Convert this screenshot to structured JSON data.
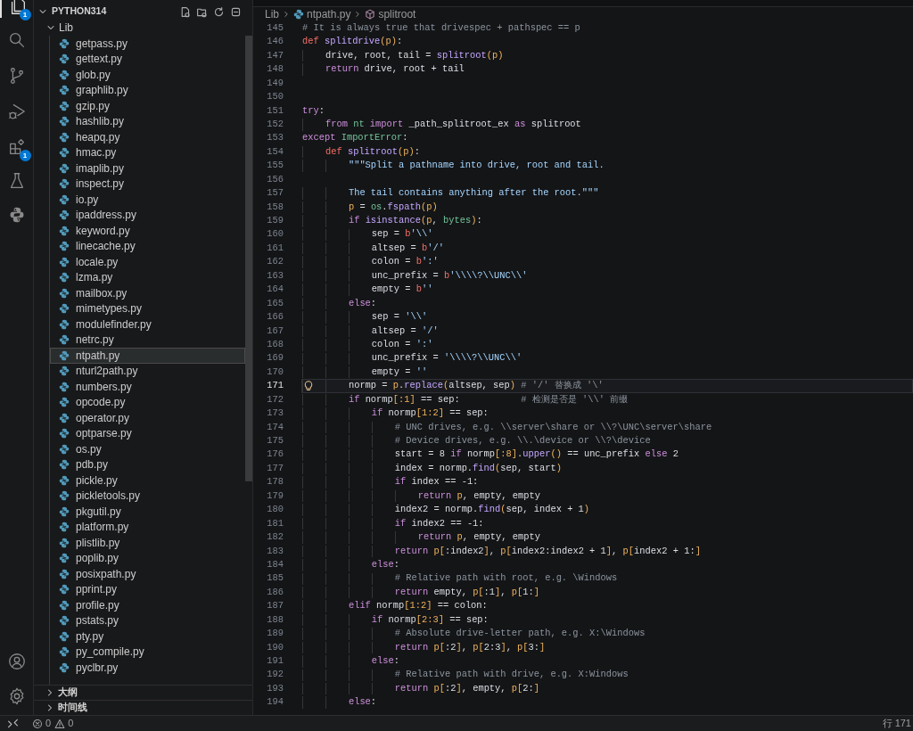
{
  "activity_bar": [
    {
      "kind": "files",
      "badge": "1",
      "selected": true
    },
    {
      "kind": "search",
      "selected": false
    },
    {
      "kind": "source-control",
      "selected": false
    },
    {
      "kind": "run-debug",
      "selected": false
    },
    {
      "kind": "extensions",
      "badge": "1",
      "selected": false
    },
    {
      "kind": "testing",
      "selected": false
    },
    {
      "kind": "python",
      "selected": false
    }
  ],
  "activity_bottom": [
    {
      "kind": "account"
    },
    {
      "kind": "settings"
    }
  ],
  "explorer": {
    "root": "PYTHON314",
    "expanded": true,
    "tree": [
      {
        "name": "Lib",
        "expanded": true,
        "children": [
          {
            "name": "getpass.py",
            "selected": false
          },
          {
            "name": "gettext.py",
            "selected": false
          },
          {
            "name": "glob.py",
            "selected": false
          },
          {
            "name": "graphlib.py",
            "selected": false
          },
          {
            "name": "gzip.py",
            "selected": false
          },
          {
            "name": "hashlib.py",
            "selected": false
          },
          {
            "name": "heapq.py",
            "selected": false
          },
          {
            "name": "hmac.py",
            "selected": false
          },
          {
            "name": "imaplib.py",
            "selected": false
          },
          {
            "name": "inspect.py",
            "selected": false
          },
          {
            "name": "io.py",
            "selected": false
          },
          {
            "name": "ipaddress.py",
            "selected": false
          },
          {
            "name": "keyword.py",
            "selected": false
          },
          {
            "name": "linecache.py",
            "selected": false
          },
          {
            "name": "locale.py",
            "selected": false
          },
          {
            "name": "lzma.py",
            "selected": false
          },
          {
            "name": "mailbox.py",
            "selected": false
          },
          {
            "name": "mimetypes.py",
            "selected": false
          },
          {
            "name": "modulefinder.py",
            "selected": false
          },
          {
            "name": "netrc.py",
            "selected": false
          },
          {
            "name": "ntpath.py",
            "selected": true
          },
          {
            "name": "nturl2path.py",
            "selected": false
          },
          {
            "name": "numbers.py",
            "selected": false
          },
          {
            "name": "opcode.py",
            "selected": false
          },
          {
            "name": "operator.py",
            "selected": false
          },
          {
            "name": "optparse.py",
            "selected": false
          },
          {
            "name": "os.py",
            "selected": false
          },
          {
            "name": "pdb.py",
            "selected": false
          },
          {
            "name": "pickle.py",
            "selected": false
          },
          {
            "name": "pickletools.py",
            "selected": false
          },
          {
            "name": "pkgutil.py",
            "selected": false
          },
          {
            "name": "platform.py",
            "selected": false
          },
          {
            "name": "plistlib.py",
            "selected": false
          },
          {
            "name": "poplib.py",
            "selected": false
          },
          {
            "name": "posixpath.py",
            "selected": false
          },
          {
            "name": "pprint.py",
            "selected": false
          },
          {
            "name": "profile.py",
            "selected": false
          },
          {
            "name": "pstats.py",
            "selected": false
          },
          {
            "name": "pty.py",
            "selected": false
          },
          {
            "name": "py_compile.py",
            "selected": false
          },
          {
            "name": "pyclbr.py",
            "selected": false
          }
        ]
      }
    ],
    "sections": [
      {
        "label": "大纲",
        "expanded": false
      },
      {
        "label": "时间线",
        "expanded": false
      }
    ]
  },
  "breadcrumb": [
    {
      "kind": "folder",
      "label": "Lib"
    },
    {
      "kind": "file",
      "label": "ntpath.py"
    },
    {
      "kind": "symbol",
      "label": "splitroot"
    }
  ],
  "code": [
    {
      "n": "145",
      "current": false,
      "tokens": [
        {
          "text": "# It is always true that drivespec + pathspec == p",
          "kind": "comment"
        }
      ]
    },
    {
      "n": "146",
      "current": false,
      "tokens": [
        {
          "text": "def ",
          "kind": "def"
        },
        {
          "text": "splitdrive",
          "kind": "function"
        },
        {
          "text": "(p)",
          "kind": "param"
        },
        {
          "text": ":",
          "kind": "plain"
        }
      ]
    },
    {
      "n": "147",
      "current": false,
      "tokens": [
        {
          "text": "    drive, root, tail = ",
          "kind": "plain"
        },
        {
          "text": "splitroot",
          "kind": "function"
        },
        {
          "text": "(p)",
          "kind": "param"
        }
      ]
    },
    {
      "n": "148",
      "current": false,
      "tokens": [
        {
          "text": "    return ",
          "kind": "keyword"
        },
        {
          "text": "drive, root + tail",
          "kind": "plain"
        }
      ]
    },
    {
      "n": "149",
      "current": false
    },
    {
      "n": "150",
      "current": false
    },
    {
      "n": "151",
      "current": false,
      "tokens": [
        {
          "text": "try",
          "kind": "keyword"
        },
        {
          "text": ":",
          "kind": "plain"
        }
      ]
    },
    {
      "n": "152",
      "current": false,
      "tokens": [
        {
          "text": "    from ",
          "kind": "keyword"
        },
        {
          "text": "nt ",
          "kind": "builtin"
        },
        {
          "text": "import ",
          "kind": "keyword"
        },
        {
          "text": "_path_splitroot_ex ",
          "kind": "plain"
        },
        {
          "text": "as ",
          "kind": "keyword"
        },
        {
          "text": "splitroot",
          "kind": "plain"
        }
      ]
    },
    {
      "n": "153",
      "current": false,
      "tokens": [
        {
          "text": "except ",
          "kind": "keyword"
        },
        {
          "text": "ImportError",
          "kind": "builtin"
        },
        {
          "text": ":",
          "kind": "plain"
        }
      ]
    },
    {
      "n": "154",
      "current": false,
      "tokens": [
        {
          "text": "    def ",
          "kind": "def"
        },
        {
          "text": "splitroot",
          "kind": "function"
        },
        {
          "text": "(p)",
          "kind": "param"
        },
        {
          "text": ":",
          "kind": "plain"
        }
      ]
    },
    {
      "n": "155",
      "current": false,
      "tokens": [
        {
          "text": "        \"\"\"Split a pathname into drive, root and tail.",
          "kind": "string"
        }
      ]
    },
    {
      "n": "156",
      "current": false
    },
    {
      "n": "157",
      "current": false,
      "tokens": [
        {
          "text": "        The tail contains anything after the root.\"\"\"",
          "kind": "string"
        }
      ]
    },
    {
      "n": "158",
      "current": false,
      "tokens": [
        {
          "text": "        p",
          "kind": "param"
        },
        {
          "text": " = ",
          "kind": "plain"
        },
        {
          "text": "os",
          "kind": "builtin"
        },
        {
          "text": ".",
          "kind": "plain"
        },
        {
          "text": "fspath",
          "kind": "function"
        },
        {
          "text": "(p)",
          "kind": "param"
        }
      ]
    },
    {
      "n": "159",
      "current": false,
      "tokens": [
        {
          "text": "        if ",
          "kind": "keyword"
        },
        {
          "text": "isinstance",
          "kind": "function"
        },
        {
          "text": "(p",
          "kind": "param"
        },
        {
          "text": ", ",
          "kind": "plain"
        },
        {
          "text": "bytes",
          "kind": "builtin"
        },
        {
          "text": ")",
          "kind": "param"
        },
        {
          "text": ":",
          "kind": "plain"
        }
      ]
    },
    {
      "n": "160",
      "current": false,
      "tokens": [
        {
          "text": "            sep = ",
          "kind": "plain"
        },
        {
          "text": "b",
          "kind": "prefix"
        },
        {
          "text": "'\\\\'",
          "kind": "string"
        }
      ]
    },
    {
      "n": "161",
      "current": false,
      "tokens": [
        {
          "text": "            altsep = ",
          "kind": "plain"
        },
        {
          "text": "b",
          "kind": "prefix"
        },
        {
          "text": "'/'",
          "kind": "string"
        }
      ]
    },
    {
      "n": "162",
      "current": false,
      "tokens": [
        {
          "text": "            colon = ",
          "kind": "plain"
        },
        {
          "text": "b",
          "kind": "prefix"
        },
        {
          "text": "':'",
          "kind": "string"
        }
      ]
    },
    {
      "n": "163",
      "current": false,
      "tokens": [
        {
          "text": "            unc_prefix = ",
          "kind": "plain"
        },
        {
          "text": "b",
          "kind": "prefix"
        },
        {
          "text": "'\\\\\\\\?\\\\UNC\\\\'",
          "kind": "string"
        }
      ]
    },
    {
      "n": "164",
      "current": false,
      "tokens": [
        {
          "text": "            empty = ",
          "kind": "plain"
        },
        {
          "text": "b",
          "kind": "prefix"
        },
        {
          "text": "''",
          "kind": "string"
        }
      ]
    },
    {
      "n": "165",
      "current": false,
      "tokens": [
        {
          "text": "        else",
          "kind": "keyword"
        },
        {
          "text": ":",
          "kind": "plain"
        }
      ]
    },
    {
      "n": "166",
      "current": false,
      "tokens": [
        {
          "text": "            sep = ",
          "kind": "plain"
        },
        {
          "text": "'\\\\'",
          "kind": "string"
        }
      ]
    },
    {
      "n": "167",
      "current": false,
      "tokens": [
        {
          "text": "            altsep = ",
          "kind": "plain"
        },
        {
          "text": "'/'",
          "kind": "string"
        }
      ]
    },
    {
      "n": "168",
      "current": false,
      "tokens": [
        {
          "text": "            colon = ",
          "kind": "plain"
        },
        {
          "text": "':'",
          "kind": "string"
        }
      ]
    },
    {
      "n": "169",
      "current": false,
      "tokens": [
        {
          "text": "            unc_prefix = ",
          "kind": "plain"
        },
        {
          "text": "'\\\\\\\\?\\\\UNC\\\\'",
          "kind": "string"
        }
      ]
    },
    {
      "n": "170",
      "current": false,
      "tokens": [
        {
          "text": "            empty = ",
          "kind": "plain"
        },
        {
          "text": "''",
          "kind": "string"
        }
      ]
    },
    {
      "n": "171",
      "current": true,
      "tokens": [
        {
          "text": "        normp = ",
          "kind": "plain"
        },
        {
          "text": "p",
          "kind": "param"
        },
        {
          "text": ".",
          "kind": "plain"
        },
        {
          "text": "replace",
          "kind": "function"
        },
        {
          "text": "(",
          "kind": "param"
        },
        {
          "text": "altsep, sep",
          "kind": "plain"
        },
        {
          "text": ")",
          "kind": "param"
        },
        {
          "text": " # '/' 替换成 '\\'",
          "kind": "comment"
        }
      ]
    },
    {
      "n": "172",
      "current": false,
      "tokens": [
        {
          "text": "        if ",
          "kind": "keyword"
        },
        {
          "text": "normp",
          "kind": "plain"
        },
        {
          "text": "[:1]",
          "kind": "param"
        },
        {
          "text": " == sep:           ",
          "kind": "plain"
        },
        {
          "text": "# 检测是否是 '\\\\' 前缀",
          "kind": "comment"
        }
      ]
    },
    {
      "n": "173",
      "current": false,
      "tokens": [
        {
          "text": "            if ",
          "kind": "keyword"
        },
        {
          "text": "normp",
          "kind": "plain"
        },
        {
          "text": "[1:2]",
          "kind": "param"
        },
        {
          "text": " == sep:",
          "kind": "plain"
        }
      ]
    },
    {
      "n": "174",
      "current": false,
      "tokens": [
        {
          "text": "                # UNC drives, e.g. \\\\server\\share or \\\\?\\UNC\\server\\share",
          "kind": "comment"
        }
      ]
    },
    {
      "n": "175",
      "current": false,
      "tokens": [
        {
          "text": "                # Device drives, e.g. \\\\.\\device or \\\\?\\device",
          "kind": "comment"
        }
      ]
    },
    {
      "n": "176",
      "current": false,
      "tokens": [
        {
          "text": "                start = 8 ",
          "kind": "plain"
        },
        {
          "text": "if ",
          "kind": "keyword"
        },
        {
          "text": "normp",
          "kind": "plain"
        },
        {
          "text": "[:8]",
          "kind": "param"
        },
        {
          "text": ".",
          "kind": "plain"
        },
        {
          "text": "upper",
          "kind": "function"
        },
        {
          "text": "()",
          "kind": "param"
        },
        {
          "text": " == unc_prefix ",
          "kind": "plain"
        },
        {
          "text": "else ",
          "kind": "keyword"
        },
        {
          "text": "2",
          "kind": "plain"
        }
      ]
    },
    {
      "n": "177",
      "current": false,
      "tokens": [
        {
          "text": "                index = normp.",
          "kind": "plain"
        },
        {
          "text": "find",
          "kind": "function"
        },
        {
          "text": "(",
          "kind": "param"
        },
        {
          "text": "sep, start",
          "kind": "plain"
        },
        {
          "text": ")",
          "kind": "param"
        }
      ]
    },
    {
      "n": "178",
      "current": false,
      "tokens": [
        {
          "text": "                if ",
          "kind": "keyword"
        },
        {
          "text": "index == -1:",
          "kind": "plain"
        }
      ]
    },
    {
      "n": "179",
      "current": false,
      "tokens": [
        {
          "text": "                    return ",
          "kind": "keyword"
        },
        {
          "text": "p",
          "kind": "param"
        },
        {
          "text": ", empty, empty",
          "kind": "plain"
        }
      ]
    },
    {
      "n": "180",
      "current": false,
      "tokens": [
        {
          "text": "                index2 = normp.",
          "kind": "plain"
        },
        {
          "text": "find",
          "kind": "function"
        },
        {
          "text": "(",
          "kind": "param"
        },
        {
          "text": "sep, index + 1",
          "kind": "plain"
        },
        {
          "text": ")",
          "kind": "param"
        }
      ]
    },
    {
      "n": "181",
      "current": false,
      "tokens": [
        {
          "text": "                if ",
          "kind": "keyword"
        },
        {
          "text": "index2 == -1:",
          "kind": "plain"
        }
      ]
    },
    {
      "n": "182",
      "current": false,
      "tokens": [
        {
          "text": "                    return ",
          "kind": "keyword"
        },
        {
          "text": "p",
          "kind": "param"
        },
        {
          "text": ", empty, empty",
          "kind": "plain"
        }
      ]
    },
    {
      "n": "183",
      "current": false,
      "tokens": [
        {
          "text": "                return ",
          "kind": "keyword"
        },
        {
          "text": "p[",
          "kind": "param"
        },
        {
          "text": ":index2",
          "kind": "plain"
        },
        {
          "text": "]",
          "kind": "param"
        },
        {
          "text": ", ",
          "kind": "plain"
        },
        {
          "text": "p[",
          "kind": "param"
        },
        {
          "text": "index2:index2 + 1",
          "kind": "plain"
        },
        {
          "text": "]",
          "kind": "param"
        },
        {
          "text": ", ",
          "kind": "plain"
        },
        {
          "text": "p[",
          "kind": "param"
        },
        {
          "text": "index2 + 1:",
          "kind": "plain"
        },
        {
          "text": "]",
          "kind": "param"
        }
      ]
    },
    {
      "n": "184",
      "current": false,
      "tokens": [
        {
          "text": "            else",
          "kind": "keyword"
        },
        {
          "text": ":",
          "kind": "plain"
        }
      ]
    },
    {
      "n": "185",
      "current": false,
      "tokens": [
        {
          "text": "                # Relative path with root, e.g. \\Windows",
          "kind": "comment"
        }
      ]
    },
    {
      "n": "186",
      "current": false,
      "tokens": [
        {
          "text": "                return ",
          "kind": "keyword"
        },
        {
          "text": "empty, ",
          "kind": "plain"
        },
        {
          "text": "p[",
          "kind": "param"
        },
        {
          "text": ":1",
          "kind": "plain"
        },
        {
          "text": "]",
          "kind": "param"
        },
        {
          "text": ", ",
          "kind": "plain"
        },
        {
          "text": "p[",
          "kind": "param"
        },
        {
          "text": "1:",
          "kind": "plain"
        },
        {
          "text": "]",
          "kind": "param"
        }
      ]
    },
    {
      "n": "187",
      "current": false,
      "tokens": [
        {
          "text": "        elif ",
          "kind": "keyword"
        },
        {
          "text": "normp",
          "kind": "plain"
        },
        {
          "text": "[1:2]",
          "kind": "param"
        },
        {
          "text": " == colon:",
          "kind": "plain"
        }
      ]
    },
    {
      "n": "188",
      "current": false,
      "tokens": [
        {
          "text": "            if ",
          "kind": "keyword"
        },
        {
          "text": "normp",
          "kind": "plain"
        },
        {
          "text": "[2:3]",
          "kind": "param"
        },
        {
          "text": " == sep:",
          "kind": "plain"
        }
      ]
    },
    {
      "n": "189",
      "current": false,
      "tokens": [
        {
          "text": "                # Absolute drive-letter path, e.g. X:\\Windows",
          "kind": "comment"
        }
      ]
    },
    {
      "n": "190",
      "current": false,
      "tokens": [
        {
          "text": "                return ",
          "kind": "keyword"
        },
        {
          "text": "p[",
          "kind": "param"
        },
        {
          "text": ":2",
          "kind": "plain"
        },
        {
          "text": "]",
          "kind": "param"
        },
        {
          "text": ", ",
          "kind": "plain"
        },
        {
          "text": "p[",
          "kind": "param"
        },
        {
          "text": "2:3",
          "kind": "plain"
        },
        {
          "text": "]",
          "kind": "param"
        },
        {
          "text": ", ",
          "kind": "plain"
        },
        {
          "text": "p[",
          "kind": "param"
        },
        {
          "text": "3:",
          "kind": "plain"
        },
        {
          "text": "]",
          "kind": "param"
        }
      ]
    },
    {
      "n": "191",
      "current": false,
      "tokens": [
        {
          "text": "            else",
          "kind": "keyword"
        },
        {
          "text": ":",
          "kind": "plain"
        }
      ]
    },
    {
      "n": "192",
      "current": false,
      "tokens": [
        {
          "text": "                # Relative path with drive, e.g. X:Windows",
          "kind": "comment"
        }
      ]
    },
    {
      "n": "193",
      "current": false,
      "tokens": [
        {
          "text": "                return ",
          "kind": "keyword"
        },
        {
          "text": "p[",
          "kind": "param"
        },
        {
          "text": ":2",
          "kind": "plain"
        },
        {
          "text": "]",
          "kind": "param"
        },
        {
          "text": ", empty, ",
          "kind": "plain"
        },
        {
          "text": "p[",
          "kind": "param"
        },
        {
          "text": "2:",
          "kind": "plain"
        },
        {
          "text": "]",
          "kind": "param"
        }
      ]
    },
    {
      "n": "194",
      "current": false,
      "tokens": [
        {
          "text": "        else",
          "kind": "keyword"
        },
        {
          "text": ":",
          "kind": "plain"
        }
      ]
    }
  ],
  "status_bar": {
    "errors": "0",
    "warnings": "0",
    "position": "行 171"
  }
}
